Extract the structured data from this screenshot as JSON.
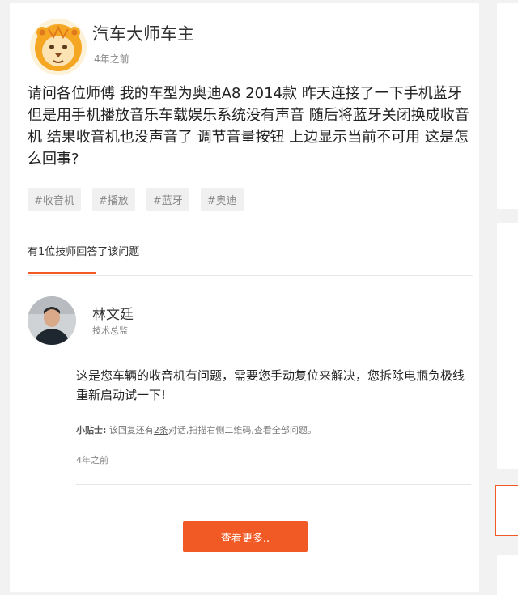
{
  "asker": {
    "name": "汽车大师车主",
    "time": "4年之前"
  },
  "question": {
    "text": "请问各位师傅 我的车型为奥迪A8 2014款 昨天连接了一下手机蓝牙 但是用手机播放音乐车载娱乐系统没有声音 随后将蓝牙关闭换成收音机 结果收音机也没声音了 调节音量按钮 上边显示当前不可用 这是怎么回事?"
  },
  "tags": [
    "#收音机",
    "#播放",
    "#蓝牙",
    "#奥迪"
  ],
  "answers_header": "有1位技师回答了该问题",
  "answer": {
    "tech_name": "林文廷",
    "tech_title": "技术总监",
    "text": "这是您车辆的收音机有问题，需要您手动复位来解决，您拆除电瓶负极线重新启动试一下!",
    "tip_label": "小贴士:",
    "tip_before": "该回复还有",
    "tip_link": "2条",
    "tip_after": "对话,扫描右侧二维码,查看全部问题。",
    "time": "4年之前"
  },
  "more_button": "查看更多..",
  "colors": {
    "accent": "#f15a24",
    "lion_mane": "#f5a623",
    "lion_face": "#fbe3b4"
  }
}
